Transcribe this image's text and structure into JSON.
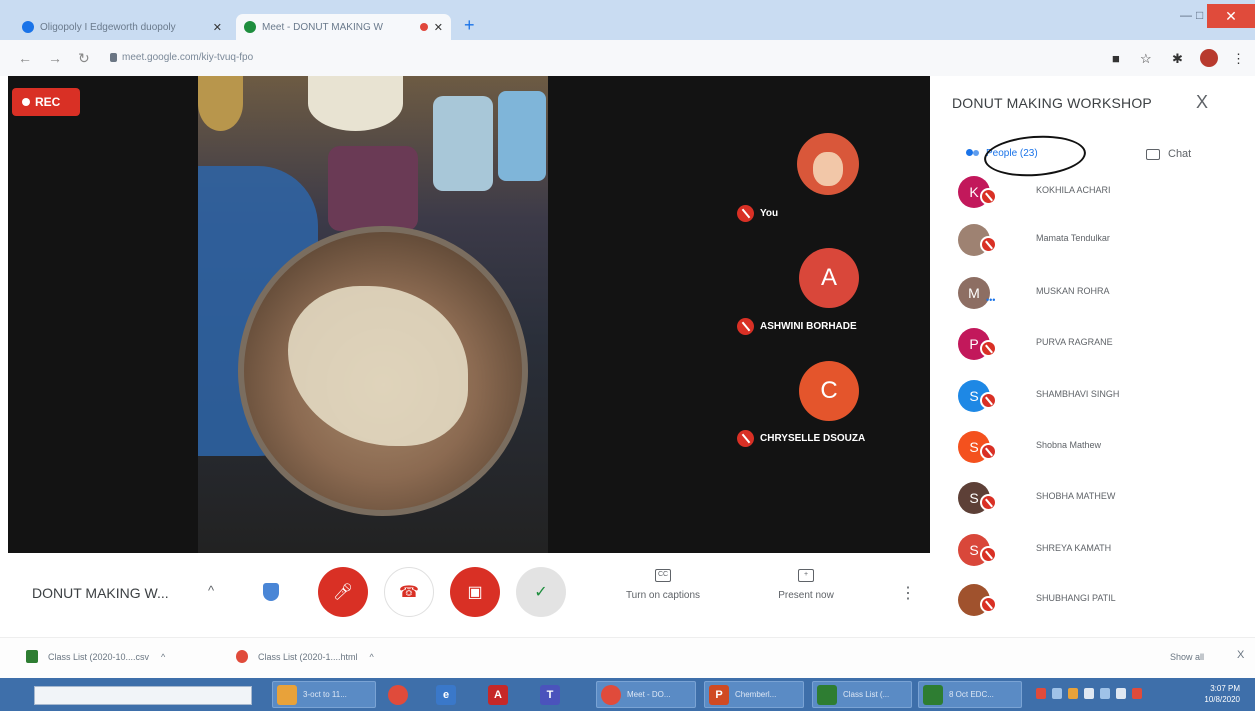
{
  "browser": {
    "tabs": [
      {
        "title": "Oligopoly I Edgeworth duopoly",
        "icon": "chrome-tab-icon"
      },
      {
        "title": "Meet - DONUT MAKING W",
        "icon": "meet-tab-icon"
      }
    ],
    "new_tab": "+",
    "url": "meet.google.com/kiy-tvuq-fpo"
  },
  "meeting": {
    "rec_label": "REC",
    "participant_tiles": [
      {
        "name": "You",
        "initial": "",
        "color": "#d9573a"
      },
      {
        "name": "ASHWINI BORHADE",
        "initial": "A",
        "color": "#d9473a"
      },
      {
        "name": "CHRYSELLE DSOUZA",
        "initial": "C",
        "color": "#e4552c"
      }
    ]
  },
  "panel": {
    "title": "DONUT MAKING WORKSHOP",
    "close": "X",
    "people_tab": "People (23)",
    "chat_tab": "Chat",
    "people": [
      {
        "initial": "K",
        "name": "KOKHILA ACHARI",
        "color": "#c2185b"
      },
      {
        "initial": "",
        "name": "Mamata Tendulkar",
        "color": "#9e8272"
      },
      {
        "initial": "M",
        "name": "MUSKAN ROHRA",
        "color": "#8d6e63"
      },
      {
        "initial": "P",
        "name": "PURVA RAGRANE",
        "color": "#c2185b"
      },
      {
        "initial": "S",
        "name": "SHAMBHAVI SINGH",
        "color": "#1e88e5"
      },
      {
        "initial": "S",
        "name": "Shobna Mathew",
        "color": "#f4511e"
      },
      {
        "initial": "S",
        "name": "SHOBHA MATHEW",
        "color": "#5d4037"
      },
      {
        "initial": "S",
        "name": "SHREYA KAMATH",
        "color": "#d9473a"
      },
      {
        "initial": "",
        "name": "SHUBHANGI PATIL",
        "color": "#a0522d"
      }
    ]
  },
  "controls": {
    "meeting_name": "DONUT MAKING W...",
    "chevron": "^",
    "captions": "Turn on captions",
    "present": "Present now",
    "captions_box": "CC"
  },
  "downloads": {
    "items": [
      "Class List (2020-10....csv",
      "Class List (2020-1....html"
    ],
    "show_all": "Show all",
    "close": "X"
  },
  "taskbar": {
    "items": [
      {
        "label": "3-oct to 11...",
        "color": "#e8a23a",
        "glyph": ""
      },
      {
        "label": "",
        "color": "#e04b3b",
        "glyph": ""
      },
      {
        "label": "",
        "color": "#3a78c9",
        "glyph": "e"
      },
      {
        "label": "",
        "color": "#c62828",
        "glyph": "A"
      },
      {
        "label": "",
        "color": "#4b53bc",
        "glyph": "T"
      },
      {
        "label": "Meet - DO...",
        "color": "#e04b3b",
        "glyph": ""
      },
      {
        "label": "Chemberl...",
        "color": "#d04a23",
        "glyph": "P"
      },
      {
        "label": "Class List (...",
        "color": "#2e7d32",
        "glyph": ""
      },
      {
        "label": "8 Oct EDC...",
        "color": "#2e7d32",
        "glyph": ""
      }
    ],
    "time": "3:07 PM",
    "date": "10/8/2020"
  }
}
